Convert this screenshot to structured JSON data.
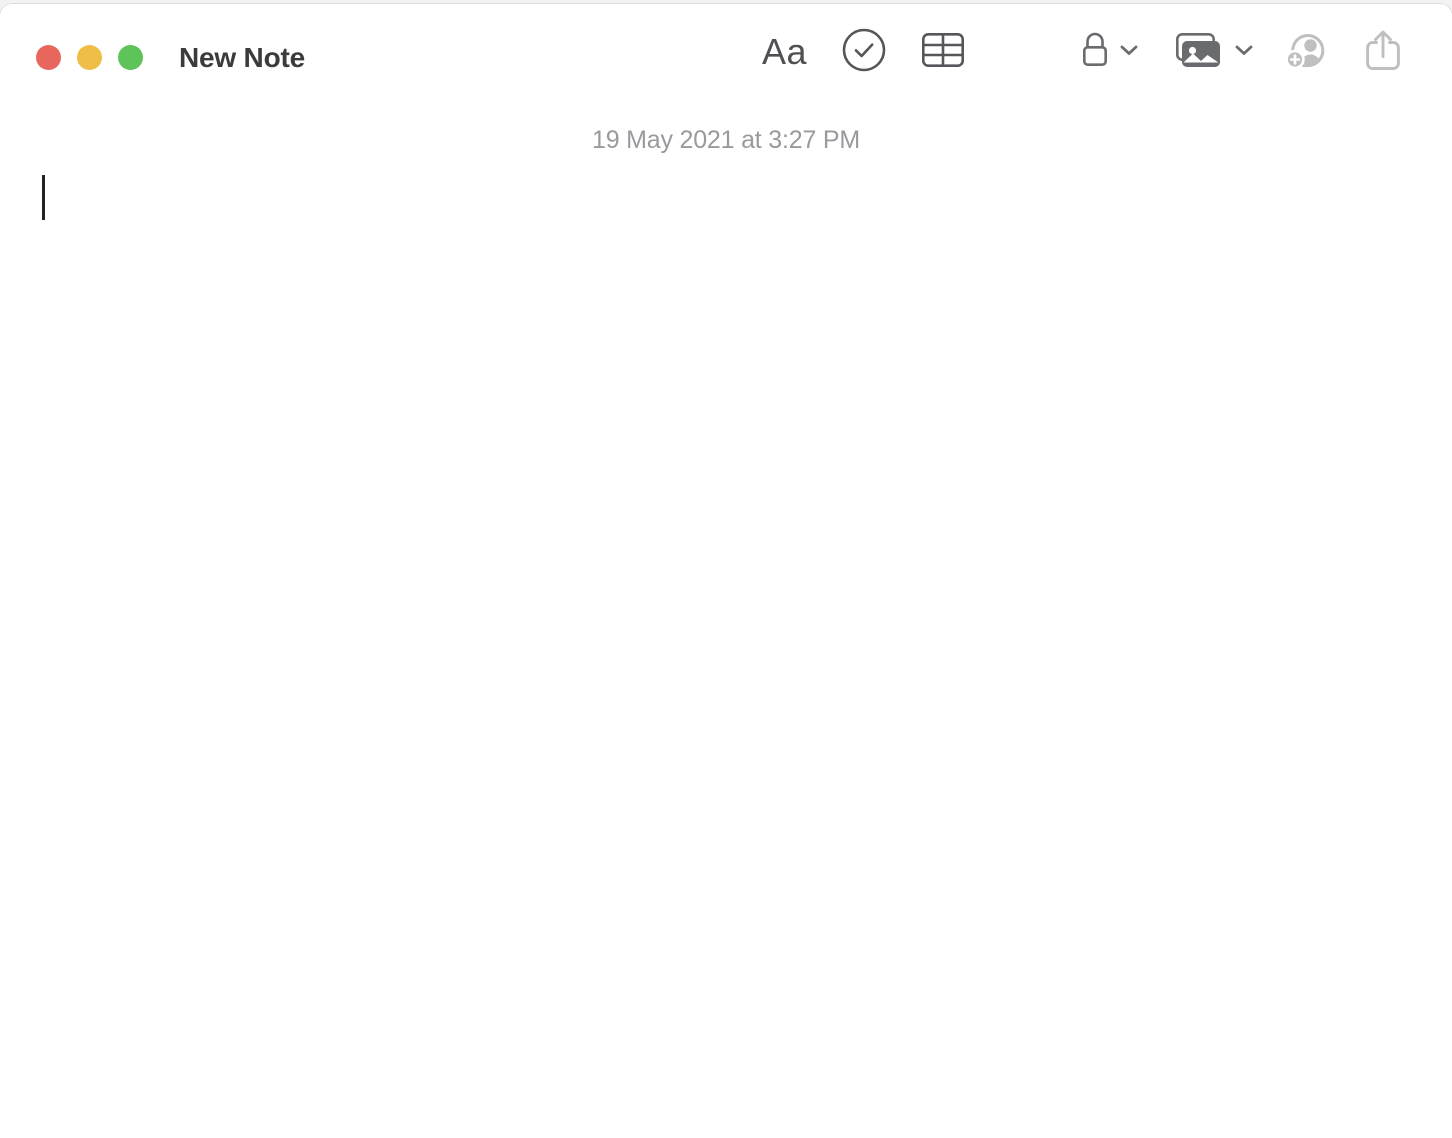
{
  "window": {
    "title": "New Note",
    "traffic_lights": [
      {
        "name": "close",
        "color": "#E8675C"
      },
      {
        "name": "minimize",
        "color": "#EFBE46"
      },
      {
        "name": "maximize",
        "color": "#5EC45A"
      }
    ]
  },
  "background": {
    "menubar_fragment": "•• •••• • ••• • •• ••• • ••"
  },
  "toolbar": {
    "center_items": [
      {
        "name": "format-aa",
        "label": "Aa",
        "tooltip": "Format"
      },
      {
        "name": "checklist",
        "label": "",
        "tooltip": "Checklist"
      },
      {
        "name": "table",
        "label": "",
        "tooltip": "Table"
      }
    ],
    "right_items": [
      {
        "name": "lock",
        "label": "",
        "tooltip": "Lock Note",
        "has_chevron": true
      },
      {
        "name": "media",
        "label": "",
        "tooltip": "Media",
        "has_chevron": true
      },
      {
        "name": "collaborate",
        "label": "",
        "tooltip": "Add People",
        "has_chevron": false
      },
      {
        "name": "share",
        "label": "",
        "tooltip": "Share",
        "has_chevron": false
      }
    ],
    "icon_color": "#55565A",
    "disabled_icon_color": "#BFBFC1"
  },
  "note": {
    "date": "19 May 2021 at 3:27 PM",
    "body_text": "",
    "caret_visible": true
  }
}
